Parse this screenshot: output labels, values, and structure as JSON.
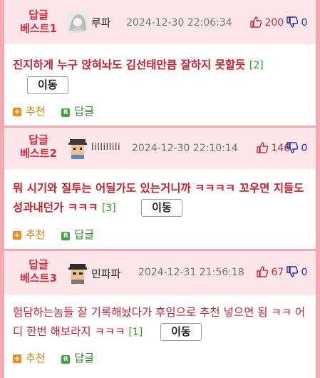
{
  "comments": [
    {
      "rank_line1": "답글",
      "rank_line2": "베스트1",
      "nickname": "루파",
      "datetime": "2024-12-30 22:06:34",
      "likes": "200",
      "dislikes": "0",
      "text": "진지하게 누구 앉혀놔도 김선태만큼 잘하지 못할듯",
      "reply_count": "[2]",
      "move_label": "이동",
      "recommend_label": "추천",
      "reply_label": "답글"
    },
    {
      "rank_line1": "답글",
      "rank_line2": "베스트2",
      "nickname": "lillillili",
      "datetime": "2024-12-30 22:10:14",
      "likes": "146",
      "dislikes": "0",
      "text": "뭐 시기와 질투는 어딜가도 있는거니까 ㅋㅋㅋㅋ 꼬우면 지들도 성과내던가 ㅋㅋㅋ",
      "reply_count": "[3]",
      "move_label": "이동",
      "recommend_label": "추천",
      "reply_label": "답글"
    },
    {
      "rank_line1": "답글",
      "rank_line2": "베스트3",
      "nickname": "민파파",
      "datetime": "2024-12-31 21:56:18",
      "likes": "67",
      "dislikes": "0",
      "text": "험담하는놈들 잘 기록해놨다가 후임으로 추천 넣으면 됨 ㅋㅋ 어디 한번 해보라지 ㅋㅋㅋ",
      "reply_count": "[1]",
      "move_label": "이동",
      "recommend_label": "추천",
      "reply_label": "답글"
    }
  ],
  "icons": {
    "recommend": "plus-icon",
    "reply": "reply-r-icon",
    "like": "thumbs-up-icon",
    "dislike": "thumbs-down-icon"
  },
  "colors": {
    "border": "#f3a9b2",
    "header_bg": "#fde6ea",
    "rank": "#d62c3a",
    "like": "#c0303b",
    "dislike": "#1f2fb0",
    "recommend": "#e07a00",
    "reply": "#2c8a2c"
  }
}
